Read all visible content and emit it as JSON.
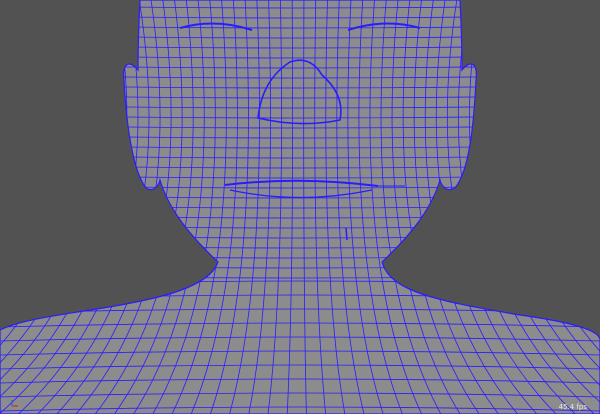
{
  "viewport": {
    "fps_label": "45.4 fps",
    "colors": {
      "background": "#525252",
      "surface": "#8c8c8c",
      "wire": "#2a1cff"
    },
    "axis_gizmo_icon": "axis-gizmo-icon"
  }
}
